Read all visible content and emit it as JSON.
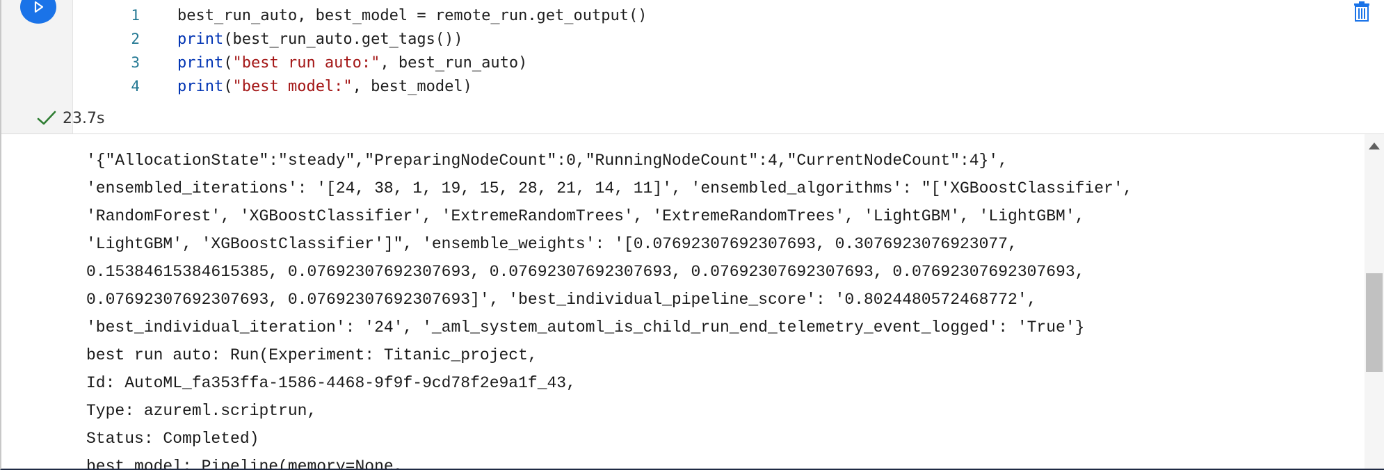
{
  "cell": {
    "code_lines": [
      {
        "num": "1",
        "parts": [
          {
            "t": "best_run_auto, best_model = remote_run.get_output()",
            "c": ""
          }
        ]
      },
      {
        "num": "2",
        "parts": [
          {
            "t": "print",
            "c": "kw"
          },
          {
            "t": "(best_run_auto.get_tags())",
            "c": ""
          }
        ]
      },
      {
        "num": "3",
        "parts": [
          {
            "t": "print",
            "c": "kw"
          },
          {
            "t": "(",
            "c": ""
          },
          {
            "t": "\"best run auto:\"",
            "c": "str"
          },
          {
            "t": ", best_run_auto)",
            "c": ""
          }
        ]
      },
      {
        "num": "4",
        "parts": [
          {
            "t": "print",
            "c": "kw"
          },
          {
            "t": "(",
            "c": ""
          },
          {
            "t": "\"best model:\"",
            "c": "str"
          },
          {
            "t": ", best_model)",
            "c": ""
          }
        ]
      }
    ],
    "duration": "23.7s",
    "colors": {
      "run_button": "#1a73e8",
      "keyword": "#0033b3",
      "string": "#a31515",
      "success": "#2e7d32"
    },
    "icons": {
      "run": "play-icon",
      "status": "checkmark-icon",
      "delete": "trash-icon"
    }
  },
  "output": {
    "lines": [
      "'{\"AllocationState\":\"steady\",\"PreparingNodeCount\":0,\"RunningNodeCount\":4,\"CurrentNodeCount\":4}',",
      "'ensembled_iterations': '[24, 38, 1, 19, 15, 28, 21, 14, 11]', 'ensembled_algorithms': \"['XGBoostClassifier',",
      "'RandomForest', 'XGBoostClassifier', 'ExtremeRandomTrees', 'ExtremeRandomTrees', 'LightGBM', 'LightGBM',",
      "'LightGBM', 'XGBoostClassifier']\", 'ensemble_weights': '[0.07692307692307693, 0.3076923076923077,",
      "0.15384615384615385, 0.07692307692307693, 0.07692307692307693, 0.07692307692307693, 0.07692307692307693,",
      "0.07692307692307693, 0.07692307692307693]', 'best_individual_pipeline_score': '0.8024480572468772',",
      "'best_individual_iteration': '24', '_aml_system_automl_is_child_run_end_telemetry_event_logged': 'True'}",
      "best run auto: Run(Experiment: Titanic_project,",
      "Id: AutoML_fa353ffa-1586-4468-9f9f-9cd78f2e9a1f_43,",
      "Type: azureml.scriptrun,",
      "Status: Completed)",
      "best model: Pipeline(memory=None,"
    ]
  }
}
